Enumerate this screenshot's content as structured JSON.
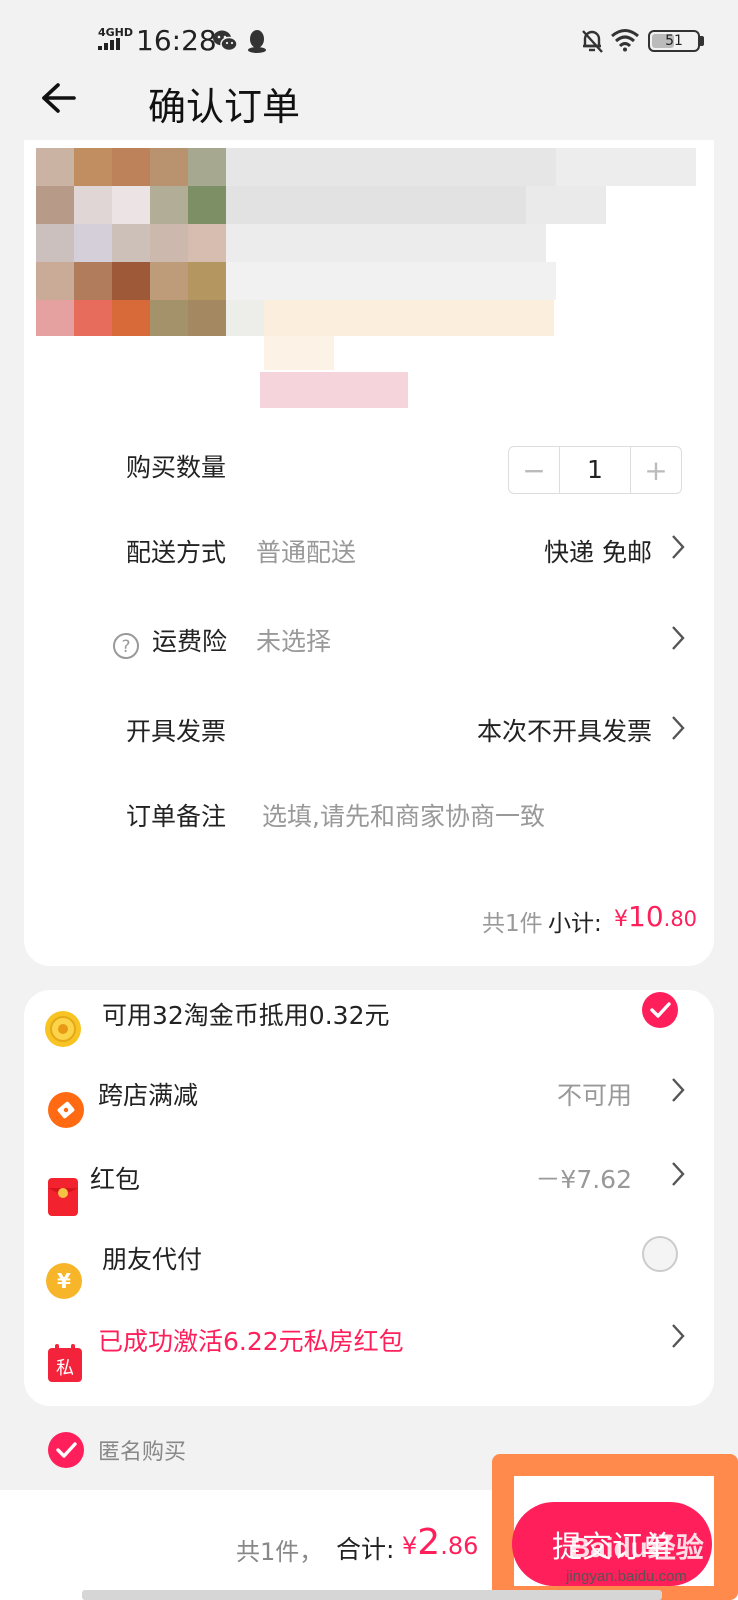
{
  "status_bar": {
    "network": "4GHD",
    "time": "16:28",
    "battery": "51",
    "battery_level_percent": 51,
    "icons": [
      "wechat-icon",
      "qq-icon",
      "mute-bell-icon",
      "wifi-icon",
      "battery-icon"
    ]
  },
  "header": {
    "title": "确认订单",
    "back_icon": "arrow-left-icon"
  },
  "order": {
    "quantity": {
      "label": "购买数量",
      "value": "1",
      "minus": "−",
      "plus": "+"
    },
    "delivery": {
      "label": "配送方式",
      "hint": "普通配送",
      "value": "快递 免邮"
    },
    "insurance": {
      "label": "运费险",
      "hint": "未选择",
      "icon": "question-circle-icon"
    },
    "invoice": {
      "label": "开具发票",
      "value": "本次不开具发票"
    },
    "note": {
      "label": "订单备注",
      "placeholder": "选填,请先和商家协商一致"
    },
    "subtotal": {
      "count": "共1件",
      "label": "小计:",
      "currency": "¥",
      "integer": "10",
      "decimal": ".80"
    }
  },
  "discounts": {
    "coins": {
      "label": "可用32淘金币抵用0.32元",
      "checked": true
    },
    "cross_store": {
      "label": "跨店满减",
      "value": "不可用"
    },
    "red_packet": {
      "label": "红包",
      "value": "－¥7.62"
    },
    "friend_pay": {
      "label": "朋友代付",
      "checked": false
    },
    "private_packet": {
      "label": "已成功激活6.22元私房红包",
      "icon_text": "私"
    }
  },
  "anonymous": {
    "label": "匿名购买",
    "checked": true
  },
  "footer": {
    "count": "共1件，",
    "total_label": "合计:",
    "currency": "¥",
    "integer": "2",
    "decimal": ".86",
    "submit_label": "提交订单"
  },
  "watermark": {
    "text": "Baidu经验",
    "url": "jingyan.baidu.com"
  },
  "colors": {
    "accent": "#ff1f5a",
    "highlight": "#ff8a4c",
    "background": "#f2f2f2",
    "card": "#ffffff"
  }
}
